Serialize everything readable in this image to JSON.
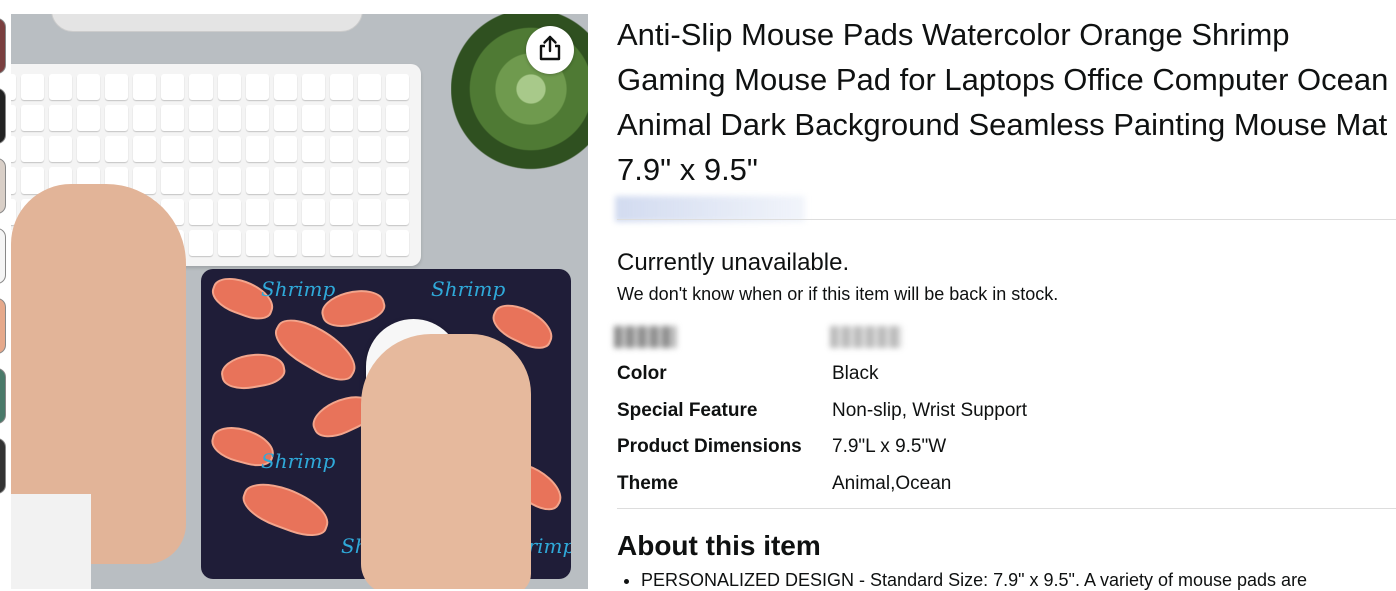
{
  "product": {
    "title": "Anti-Slip Mouse Pads Watercolor Orange Shrimp Gaming Mouse Pad for Laptops Office Computer Ocean Animal Dark Background Seamless Painting Mouse Mat 7.9\" x 9.5\"",
    "image_text": "Shrimp"
  },
  "availability": {
    "status": "Currently unavailable.",
    "note": "We don't know when or if this item will be back in stock."
  },
  "attributes": [
    {
      "key": "Color",
      "value": "Black"
    },
    {
      "key": "Special Feature",
      "value": "Non-slip, Wrist Support"
    },
    {
      "key": "Product Dimensions",
      "value": "7.9\"L x 9.5\"W"
    },
    {
      "key": "Theme",
      "value": "Animal,Ocean"
    }
  ],
  "about": {
    "heading": "About this item",
    "bullets": [
      "PERSONALIZED DESIGN - Standard Size: 7.9\" x 9.5\". A variety of mouse pads are"
    ]
  },
  "icons": {
    "share": "share-icon"
  },
  "colors": {
    "pad_background": "#1f1d38",
    "shrimp": "#e8735a",
    "script_text": "#2fa9d9"
  }
}
